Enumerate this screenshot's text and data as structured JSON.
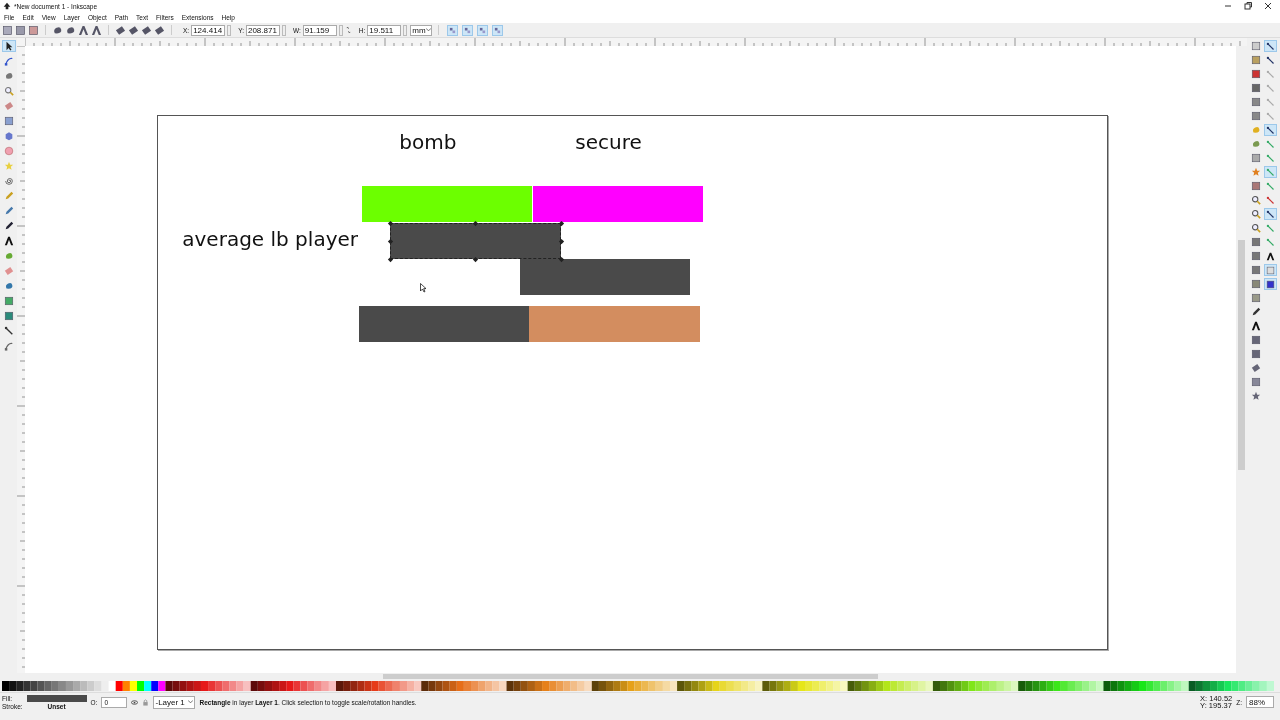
{
  "window": {
    "title": "*New document 1 - Inkscape"
  },
  "menu": [
    "File",
    "Edit",
    "View",
    "Layer",
    "Object",
    "Path",
    "Text",
    "Filters",
    "Extensions",
    "Help"
  ],
  "toolbar": {
    "fields": [
      {
        "label": "X:",
        "value": "124.414"
      },
      {
        "label": "Y:",
        "value": "208.871"
      },
      {
        "label": "W:",
        "value": "91.159"
      },
      {
        "label": "H:",
        "value": "19.511"
      }
    ],
    "unit": "mm",
    "toggles": [
      {
        "on": true
      },
      {
        "on": true
      },
      {
        "on": true
      },
      {
        "on": true
      }
    ]
  },
  "toolbox": [
    {
      "selected": true
    },
    {
      "selected": false
    },
    {
      "selected": false
    },
    {
      "selected": false
    },
    {
      "selected": false
    },
    {
      "selected": false
    },
    {
      "selected": false
    },
    {
      "selected": false
    },
    {
      "selected": false
    },
    {
      "selected": false
    },
    {
      "selected": false
    },
    {
      "selected": false
    },
    {
      "selected": false
    },
    {
      "selected": false
    },
    {
      "selected": false
    },
    {
      "selected": false
    },
    {
      "selected": false
    },
    {
      "selected": false
    },
    {
      "selected": false
    },
    {
      "selected": false
    },
    {
      "selected": false
    }
  ],
  "canvas": {
    "texts": [
      "bomb",
      "secure",
      "average lb player"
    ],
    "shapes": [
      {
        "color": "#6cff00",
        "selected": false
      },
      {
        "color": "#ff00ff",
        "selected": false
      },
      {
        "color": "#4a4a4a",
        "selected": true
      },
      {
        "color": "#4a4a4a",
        "selected": false
      },
      {
        "color": "#4a4a4a",
        "selected": false
      },
      {
        "color": "#d38d5f",
        "selected": false
      }
    ]
  },
  "snap_bar": [
    {
      "on": true
    },
    {
      "on": false
    },
    {
      "on": false
    },
    {
      "on": false
    },
    {
      "on": false
    },
    {
      "on": false
    },
    {
      "on": true
    },
    {
      "on": false
    },
    {
      "on": false
    },
    {
      "on": true
    },
    {
      "on": false
    },
    {
      "on": false
    },
    {
      "on": true
    },
    {
      "on": false
    },
    {
      "on": false
    },
    {
      "on": false
    },
    {
      "on": true
    },
    {
      "on": true
    }
  ],
  "status_bar": {
    "fill_label": "Fill:",
    "stroke_label": "Stroke:",
    "stroke_value": "Unset",
    "opacity_label": "O:",
    "opacity": "0",
    "layer": "-Layer 1",
    "message": "**Rectangle** in layer **Layer 1**. Click selection to toggle scale/rotation handles.",
    "cursor_x": "X: 140.52",
    "cursor_y": "Y: 195.37",
    "zoom_label": "Z:",
    "zoom": "88%"
  }
}
